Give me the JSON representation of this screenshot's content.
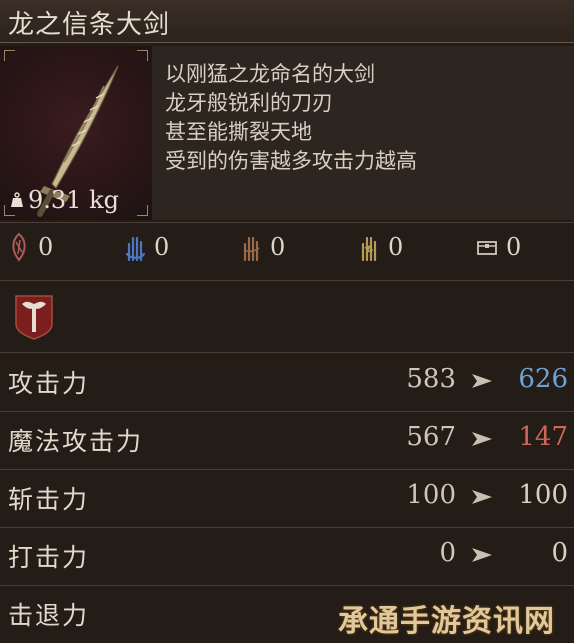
{
  "item": {
    "title": "龙之信条大剑",
    "weight": "9.31 kg",
    "description": [
      "以刚猛之龙命名的大剑",
      "龙牙般锐利的刀刃",
      "甚至能撕裂天地",
      "受到的伤害越多攻击力越高"
    ]
  },
  "resistances": [
    {
      "icon": "blood-claw-icon",
      "value": "0",
      "color": "#b05a5a"
    },
    {
      "icon": "magic-hand-icon",
      "value": "0",
      "color": "#4b78c2"
    },
    {
      "icon": "fire-claw-icon",
      "value": "0",
      "color": "#9a6a4a"
    },
    {
      "icon": "lightning-claw-icon",
      "value": "0",
      "color": "#b59a5a"
    },
    {
      "icon": "chest-icon",
      "value": "0",
      "color": "#cfc6b8"
    }
  ],
  "badge_icon": "axe-hammer-badge-icon",
  "stats": [
    {
      "label": "攻击力",
      "current": "583",
      "next": "626",
      "next_color": "#6fa0d8"
    },
    {
      "label": "魔法攻击力",
      "current": "567",
      "next": "147",
      "next_color": "#d0665a"
    },
    {
      "label": "斩击力",
      "current": "100",
      "next": "100",
      "next_color": "#d8cfc2"
    },
    {
      "label": "打击力",
      "current": "0",
      "next": "0",
      "next_color": "#d8cfc2"
    },
    {
      "label": "击退力",
      "current": "",
      "next": "",
      "next_color": "#d8cfc2"
    }
  ],
  "watermark": "承通手游资讯网"
}
